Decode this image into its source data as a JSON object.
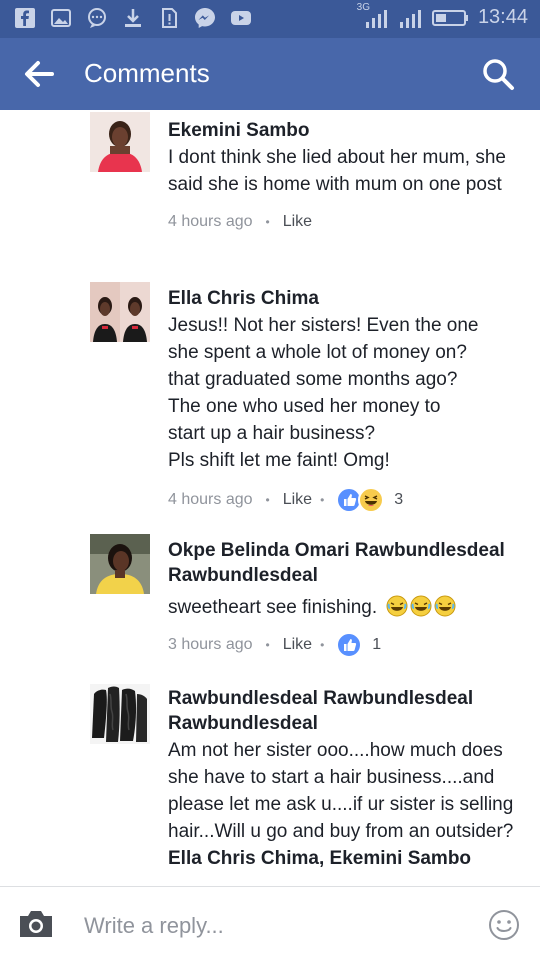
{
  "status_bar": {
    "time": "13:44",
    "network": "3G",
    "left_icons": [
      "facebook-icon",
      "gallery-icon",
      "chat-bubble-icon",
      "download-icon",
      "alert-icon",
      "messenger-icon",
      "youtube-icon"
    ],
    "color": "#3b5998"
  },
  "header": {
    "title": "Comments",
    "back_icon": "arrow-left-icon",
    "search_icon": "search-icon",
    "color": "#4867aa"
  },
  "comments": [
    {
      "author": "Ekemini Sambo",
      "text": "I dont think she lied about her mum, she said she is home with mum on one post",
      "time": "4 hours ago",
      "like_label": "Like",
      "reactions": null
    },
    {
      "author": "Ella Chris Chima",
      "text_lines": [
        "Jesus!! Not her sisters! Even the one",
        "she spent a whole lot of money on?",
        "that graduated some months ago?",
        "The one who used her money to",
        "start up a hair business?",
        "Pls shift let me faint! Omg!"
      ],
      "time": "4 hours ago",
      "like_label": "Like",
      "reactions": {
        "icons": [
          "like-reaction-icon",
          "haha-reaction-icon"
        ],
        "count": "3"
      }
    },
    {
      "author": "Okpe Belinda Omari Rawbundlesdeal Rawbundlesdeal",
      "text": "sweetheart see finishing.",
      "time": "3 hours ago",
      "like_label": "Like",
      "reactions": {
        "icons": [
          "like-reaction-icon"
        ],
        "count": "1"
      }
    },
    {
      "author": "Rawbundlesdeal Rawbundlesdeal Rawbundlesdeal",
      "text": "Am not her sister ooo....how much does she have to start a hair business....and please let me ask u....if ur sister is selling hair...Will u go and buy from an outsider?",
      "tags": "Ella Chris Chima, Ekemini Sambo"
    }
  ],
  "reply_bar": {
    "placeholder": "Write a reply...",
    "camera_icon": "camera-icon",
    "emoji_icon": "smiley-icon"
  }
}
